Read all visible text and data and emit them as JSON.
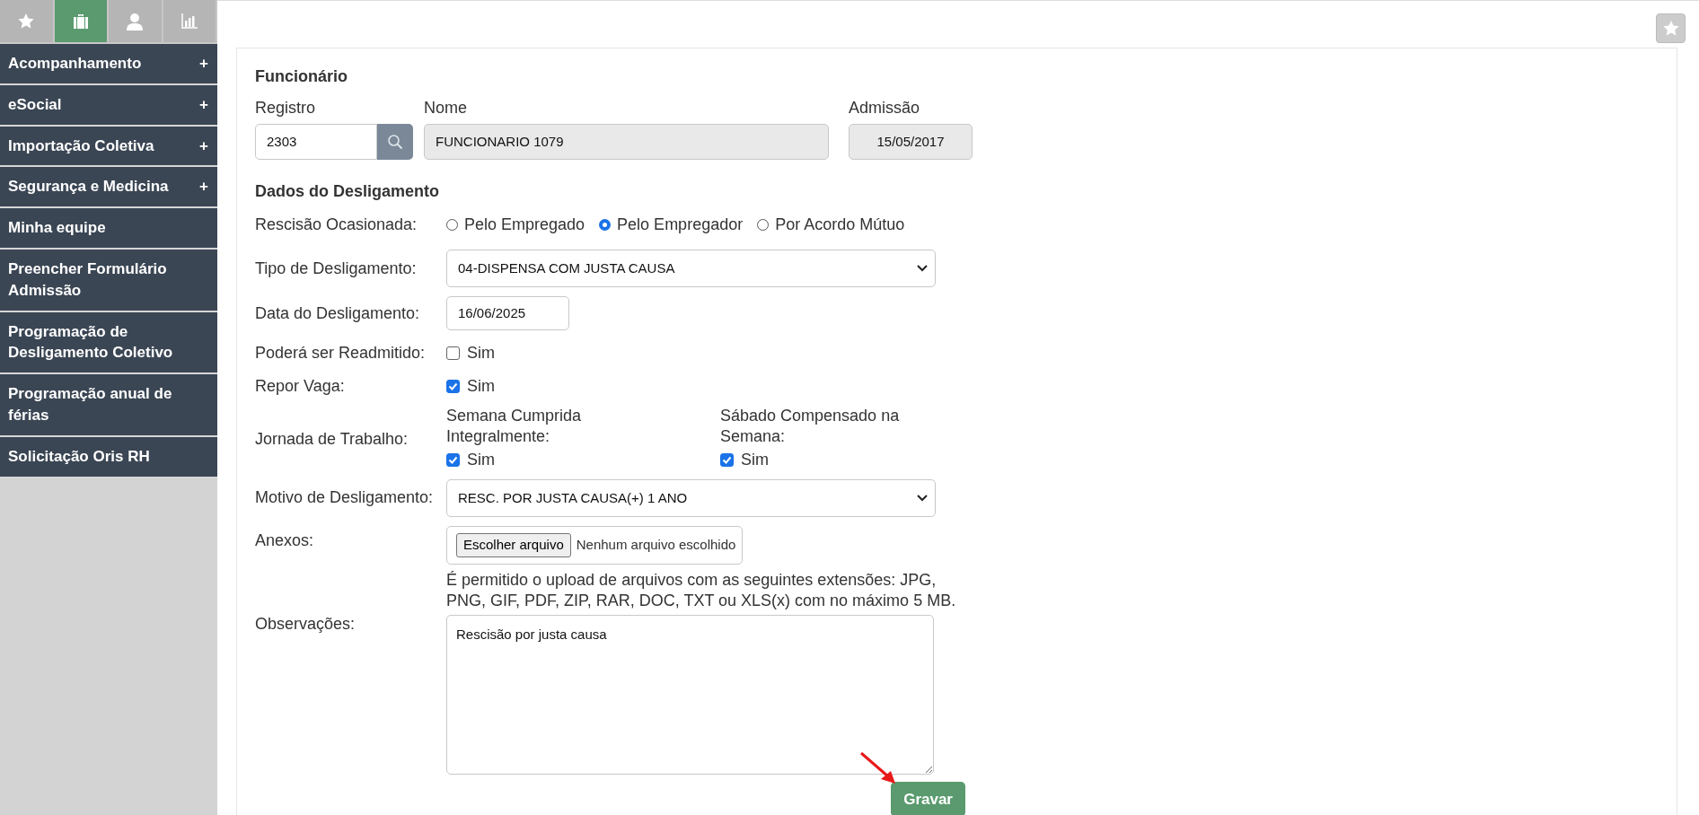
{
  "sidebar": {
    "tabs": [
      {
        "selected": false
      },
      {
        "selected": true
      },
      {
        "selected": false
      },
      {
        "selected": false
      }
    ],
    "menu": [
      {
        "label": "Acompanhamento",
        "toggle": "+"
      },
      {
        "label": "eSocial",
        "toggle": "+"
      },
      {
        "label": "Importação Coletiva",
        "toggle": "+"
      },
      {
        "label": "Segurança e Medicina",
        "toggle": "+"
      },
      {
        "label": "Minha equipe"
      },
      {
        "label": "Preencher Formulário Admissão"
      },
      {
        "label": "Programação de Desligamento Coletivo"
      },
      {
        "label": "Programação anual de férias"
      },
      {
        "label": "Solicitação Oris RH"
      }
    ]
  },
  "employee": {
    "title": "Funcionário",
    "registro_label": "Registro",
    "registro": "2303",
    "nome_label": "Nome",
    "nome": "FUNCIONARIO 1079",
    "admissao_label": "Admissão",
    "admissao": "15/05/2017"
  },
  "termination": {
    "title": "Dados do Desligamento",
    "rescisao": {
      "label": "Rescisão Ocasionada:",
      "options": [
        {
          "label": "Pelo Empregado",
          "selected": false
        },
        {
          "label": "Pelo Empregador",
          "selected": true
        },
        {
          "label": "Por Acordo Mútuo",
          "selected": false
        }
      ]
    },
    "tipo": {
      "label": "Tipo de Desligamento:",
      "value": "04-DISPENSA COM JUSTA CAUSA"
    },
    "data": {
      "label": "Data do Desligamento:",
      "value": "16/06/2025"
    },
    "readmitido": {
      "label": "Poderá ser Readmitido:",
      "option": "Sim",
      "checked": false
    },
    "repor_vaga": {
      "label": "Repor Vaga:",
      "option": "Sim",
      "checked": true
    },
    "jornada": {
      "label": "Jornada de Trabalho:",
      "items": [
        {
          "label": "Semana Cumprida Integralmente:",
          "option": "Sim",
          "checked": true
        },
        {
          "label": "Sábado Compensado na Semana:",
          "option": "Sim",
          "checked": true
        }
      ]
    },
    "motivo": {
      "label": "Motivo de Desligamento:",
      "value": "RESC. POR JUSTA CAUSA(+) 1 ANO"
    },
    "anexos": {
      "label": "Anexos:",
      "button": "Escolher arquivo",
      "status": "Nenhum arquivo escolhido",
      "help": "É permitido o upload de arquivos com as seguintes extensões: JPG, PNG, GIF, PDF, ZIP, RAR, DOC, TXT ou XLS(x) com no máximo 5 MB."
    },
    "observacoes": {
      "label": "Observações:",
      "value": "Rescisão por justa causa"
    }
  },
  "save_button": "Gravar"
}
